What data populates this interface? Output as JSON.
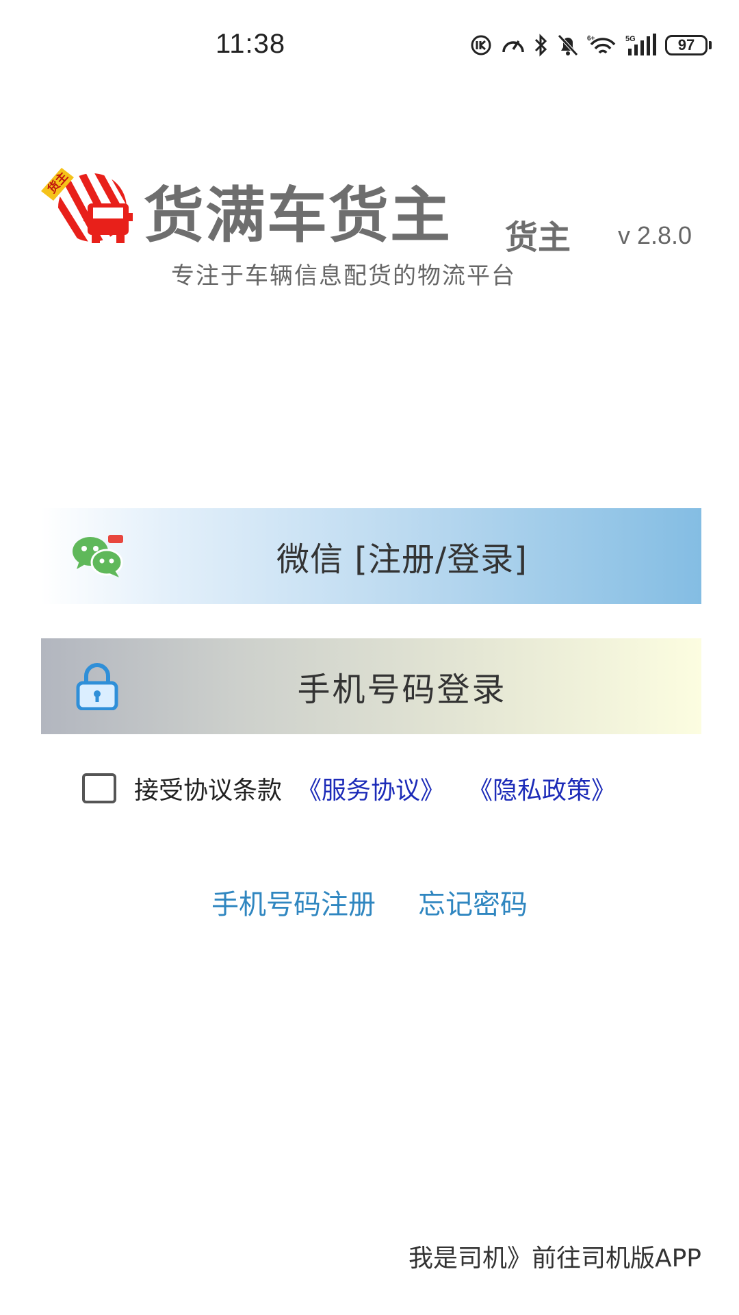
{
  "status_bar": {
    "time": "11:38",
    "battery": "97",
    "icons": [
      "nfc-icon",
      "speedometer-icon",
      "bluetooth-icon",
      "bell-muted-icon",
      "wifi-icon",
      "signal-5g-icon",
      "battery-icon"
    ]
  },
  "header": {
    "logo_badge": "货主",
    "app_name": "货满车货主",
    "app_tag": "货主",
    "version": "v 2.8.0",
    "slogan": "专注于车辆信息配货的物流平台"
  },
  "login": {
    "wechat_label": "微信 [注册/登录]",
    "phone_label": "手机号码登录"
  },
  "agreement": {
    "checked": false,
    "text": "接受协议条款",
    "service_link": "《服务协议》",
    "privacy_link": "《隐私政策》"
  },
  "links": {
    "register": "手机号码注册",
    "forgot": "忘记密码"
  },
  "footer": {
    "driver_link": "我是司机》前往司机版APP"
  },
  "colors": {
    "link_blue": "#2f86c0",
    "agreement_link": "#1c2bb8",
    "logo_red": "#e8201a",
    "wechat_green": "#5fb85a",
    "lock_blue": "#2f8fd8"
  }
}
